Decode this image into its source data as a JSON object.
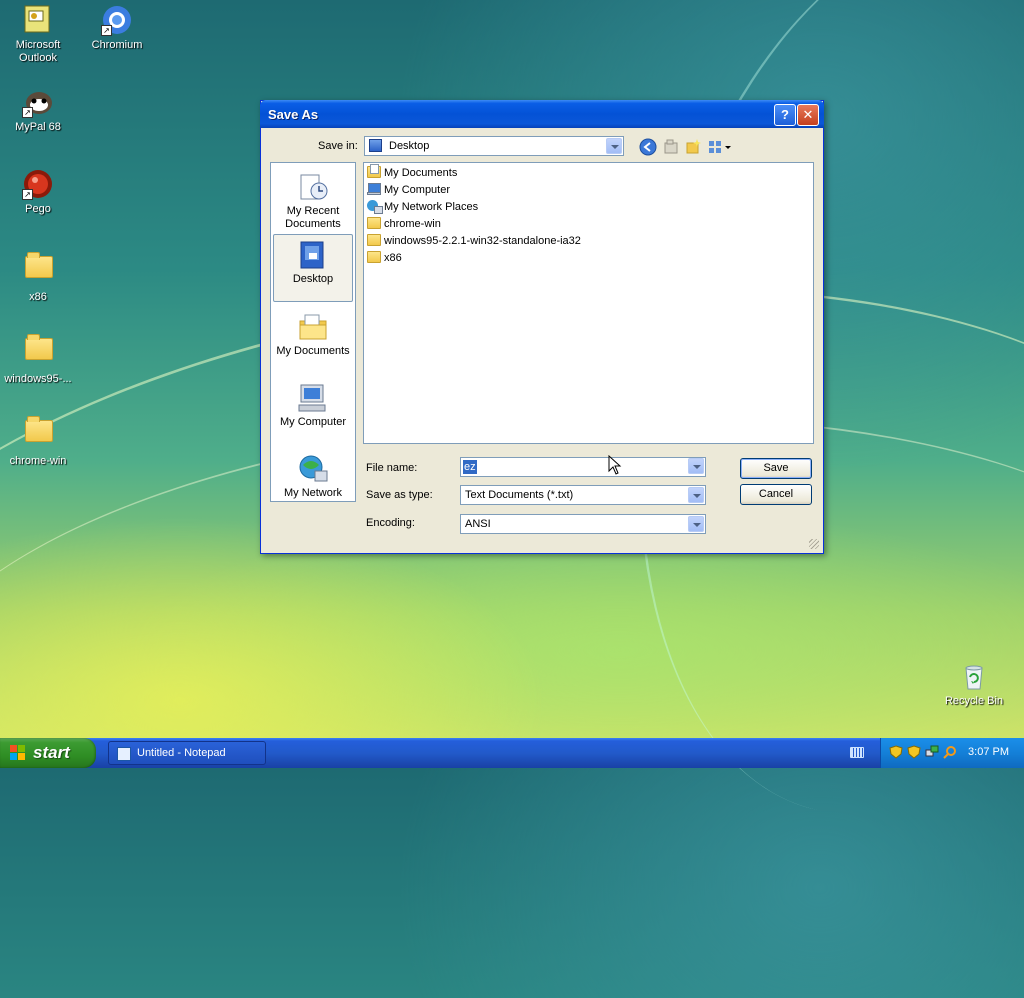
{
  "desktop": {
    "icons": [
      {
        "label": "Microsoft\nOutlook",
        "name": "outlook-icon"
      },
      {
        "label": "Chromium",
        "name": "chromium-icon"
      },
      {
        "label": "MyPal 68",
        "name": "mypal-icon"
      },
      {
        "label": "Pego",
        "name": "pego-icon"
      },
      {
        "label": "x86",
        "name": "folder-icon"
      },
      {
        "label": "windows95-...",
        "name": "folder-icon"
      },
      {
        "label": "chrome-win",
        "name": "folder-icon"
      },
      {
        "label": "Recycle Bin",
        "name": "recycle-bin-icon"
      }
    ]
  },
  "dialog": {
    "title": "Save As",
    "help_glyph": "?",
    "close_glyph": "✕",
    "save_in_label": "Save in:",
    "save_in_value": "Desktop",
    "places": [
      {
        "label": "My Recent\nDocuments"
      },
      {
        "label": "Desktop"
      },
      {
        "label": "My Documents"
      },
      {
        "label": "My Computer"
      },
      {
        "label": "My Network"
      }
    ],
    "files": [
      "My Documents",
      "My Computer",
      "My Network Places",
      "chrome-win",
      "windows95-2.2.1-win32-standalone-ia32",
      "x86"
    ],
    "file_name_label": "File name:",
    "file_name_value": "ez",
    "save_as_type_label": "Save as type:",
    "save_as_type_value": "Text Documents (*.txt)",
    "encoding_label": "Encoding:",
    "encoding_value": "ANSI",
    "save_label": "Save",
    "cancel_label": "Cancel"
  },
  "taskbar": {
    "start_label": "start",
    "task_label": "Untitled - Notepad",
    "clock": "3:07 PM"
  }
}
